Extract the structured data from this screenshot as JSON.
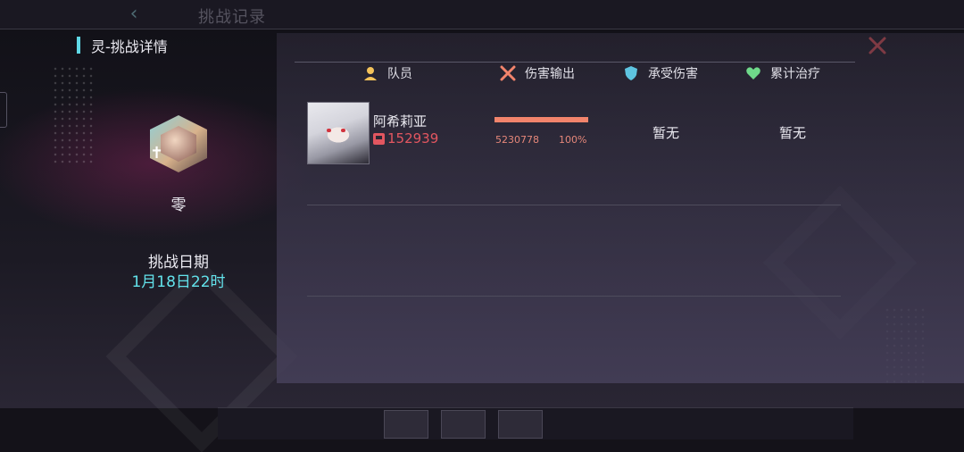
{
  "background": {
    "back_icon": "chevron-left-icon",
    "title": "挑战记录"
  },
  "modal": {
    "title": "灵-挑战详情",
    "close_icon": "close-x-icon"
  },
  "boss": {
    "name": "零"
  },
  "challenge_date": {
    "label": "挑战日期",
    "value": "1月18日22时"
  },
  "columns": [
    {
      "label": "队员",
      "icon": "member-icon"
    },
    {
      "label": "伤害输出",
      "icon": "crossed-swords-icon"
    },
    {
      "label": "承受伤害",
      "icon": "shield-icon"
    },
    {
      "label": "累计治疗",
      "icon": "heart-icon"
    }
  ],
  "members": [
    {
      "name": "阿希莉亚",
      "power": "152939",
      "damage": "5230778",
      "damage_pct_label": "100%",
      "damage_fraction": 1.0,
      "damage_taken": "暂无",
      "healing": "暂无"
    }
  ],
  "colors": {
    "accent_cyan": "#62e1ea",
    "power_red": "#e25660",
    "damage_bar": "#f2846c",
    "close_red": "#e24b4b"
  }
}
